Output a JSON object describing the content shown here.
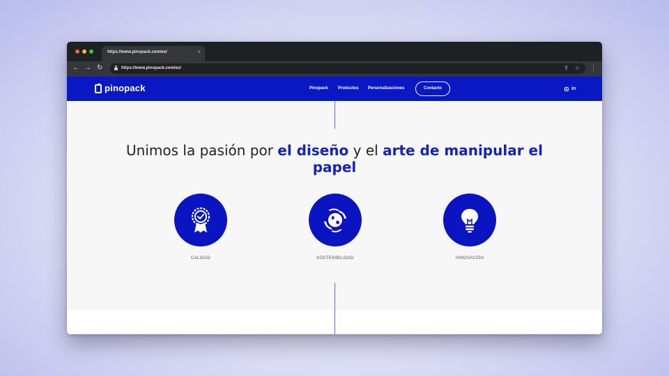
{
  "browser": {
    "tab_title": "https://www.pinopack.com/es/",
    "tab_close": "×",
    "url": "https://www.pinopack.com/es/",
    "back_icon": "←",
    "forward_icon": "→",
    "reload_icon": "↻",
    "share_icon": "⇪",
    "star_icon": "☆",
    "menu_icon": "⋮"
  },
  "site": {
    "logo_text": "pinopack",
    "nav": [
      "Pinopack",
      "Productos",
      "Personalizaciones"
    ],
    "contact_label": "Contacto",
    "linkedin": "in",
    "brand_color": "#0a18c4"
  },
  "hero": {
    "part1": "Unimos la pasión por ",
    "highlight1": "el diseño",
    "part2": " y el ",
    "highlight2": "arte de manipular el papel"
  },
  "features": [
    {
      "label": "CALIDAD",
      "icon": "quality-badge-icon"
    },
    {
      "label": "SOSTENIBILIDAD",
      "icon": "globe-hands-icon"
    },
    {
      "label": "INNOVACIÓN",
      "icon": "lightbulb-icon"
    }
  ]
}
